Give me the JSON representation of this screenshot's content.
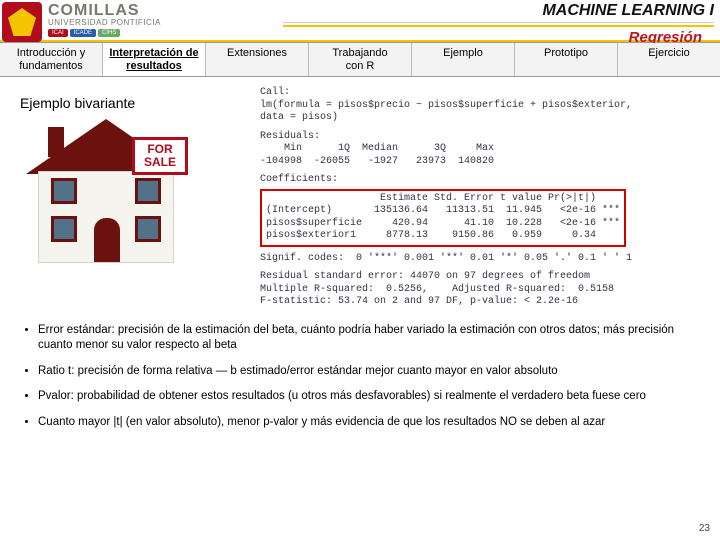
{
  "header": {
    "brand_name": "COMILLAS",
    "brand_sub": "UNIVERSIDAD PONTIFICIA",
    "badge1": "ICAI",
    "badge2": "ICADE",
    "badge3": "CIHS",
    "course": "MACHINE LEARNING I",
    "section": "Regresión"
  },
  "tabs": [
    "Introducción y\nfundamentos",
    "Interpretación de\nresultados",
    "Extensiones",
    "Trabajando\ncon R",
    "Ejemplo",
    "Prototipo",
    "Ejercicio"
  ],
  "subtitle": "Ejemplo bivariante",
  "sign": "FOR\nSALE",
  "code": {
    "l1": "Call:",
    "l2": "lm(formula = pisos$precio ~ pisos$superficie + pisos$exterior,",
    "l3": "    data = pisos)",
    "l4": "Residuals:",
    "l5": "    Min      1Q  Median      3Q     Max",
    "l6": "-104998  -26055   -1927   23973  140820",
    "l7": "Coefficients:",
    "c_h": "                   Estimate Std. Error t value Pr(>|t|)",
    "c_1": "(Intercept)       135136.64   11313.51  11.945   <2e-16 ***",
    "c_2": "pisos$superficie     420.94      41.10  10.228   <2e-16 ***",
    "c_3": "pisos$exterior1     8778.13    9150.86   0.959     0.34",
    "l8": "Signif. codes:  0 '***' 0.001 '**' 0.01 '*' 0.05 '.' 0.1 ' ' 1",
    "l9": "Residual standard error: 44070 on 97 degrees of freedom",
    "l10": "Multiple R-squared:  0.5256,    Adjusted R-squared:  0.5158",
    "l11": "F-statistic: 53.74 on 2 and 97 DF,  p-value: < 2.2e-16"
  },
  "bullets": [
    "Error estándar: precisión de la estimación del beta, cuánto podría haber variado la estimación con otros datos; más precisión cuanto menor su valor respecto al beta",
    "Ratio t: precisión de forma relativa — b estimado/error estándar mejor cuanto mayor en valor absoluto",
    "Pvalor: probabilidad de obtener estos resultados (u otros más desfavorables) si realmente el verdadero beta fuese cero",
    "Cuanto mayor |t| (en valor absoluto), menor p-valor y más evidencia de que los resultados NO se deben al azar"
  ],
  "pagenum": "23"
}
